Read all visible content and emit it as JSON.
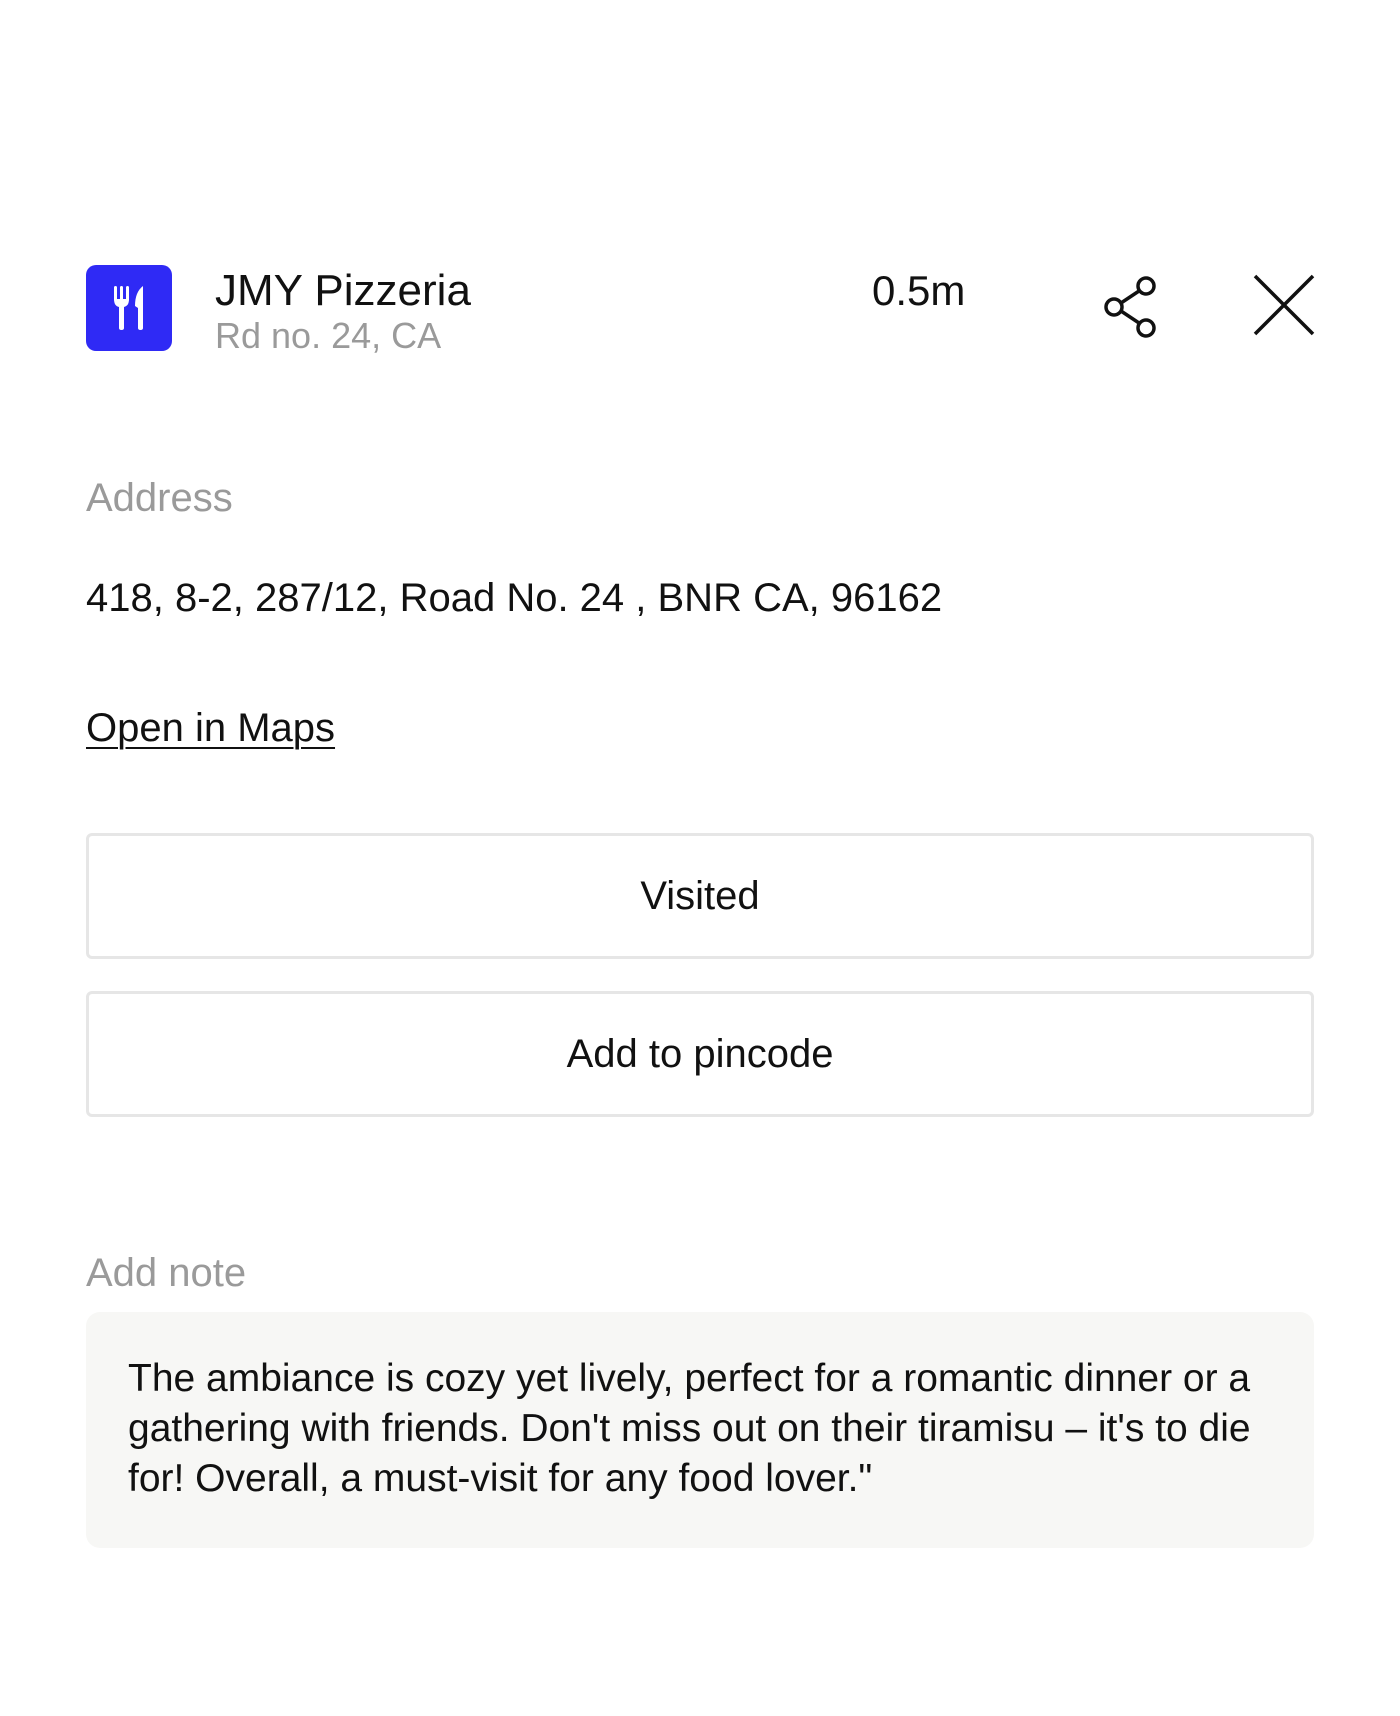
{
  "header": {
    "icon": "fork-knife-icon",
    "icon_color": "#2f2af5",
    "title": "JMY Pizzeria",
    "subtitle": "Rd no. 24, CA",
    "distance": "0.5m",
    "share_icon": "share-icon",
    "close_icon": "close-icon"
  },
  "address": {
    "label": "Address",
    "value": "418, 8-2, 287/12, Road No. 24 , BNR CA, 96162",
    "maps_link": "Open in Maps"
  },
  "actions": {
    "visited_label": "Visited",
    "pincode_label": "Add to pincode"
  },
  "note": {
    "label": "Add note",
    "text": "The ambiance is cozy yet lively, perfect for a romantic dinner or a gathering with friends. Don't miss out on their tiramisu – it's to die for! Overall, a must-visit for any food lover.\""
  }
}
